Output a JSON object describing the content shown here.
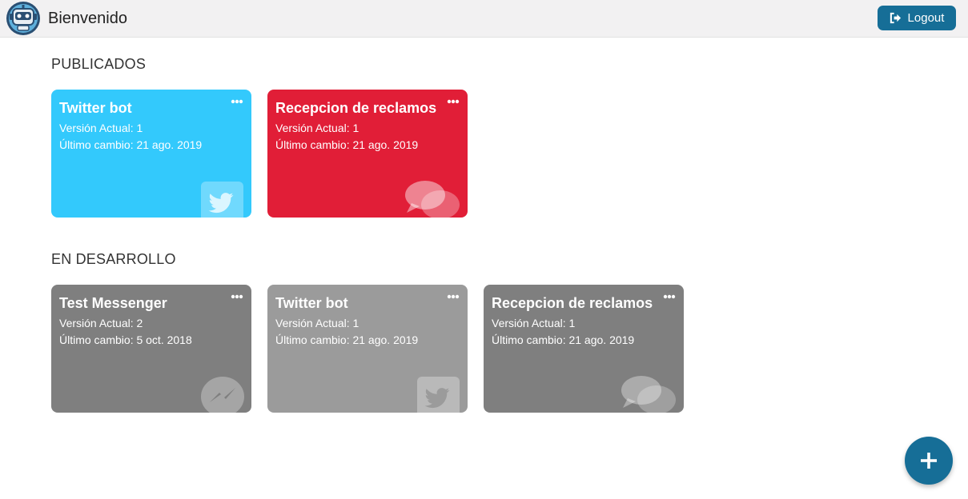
{
  "header": {
    "title": "Bienvenido",
    "logout_label": "Logout"
  },
  "sections": {
    "published": {
      "title": "PUBLICADOS",
      "cards": [
        {
          "title": "Twitter bot",
          "version": "Versión Actual: 1",
          "last_change": "Último cambio: 21 ago. 2019",
          "color": "#33c9fc",
          "icon": "twitter-icon"
        },
        {
          "title": "Recepcion de reclamos",
          "version": "Versión Actual: 1",
          "last_change": "Último cambio: 21 ago. 2019",
          "color": "#e11e37",
          "icon": "chat-bubbles-icon"
        }
      ]
    },
    "development": {
      "title": "EN DESARROLLO",
      "cards": [
        {
          "title": "Test Messenger",
          "version": "Versión Actual: 2",
          "last_change": "Último cambio: 5 oct. 2018",
          "color": "#7f7f7f",
          "icon": "messenger-icon"
        },
        {
          "title": "Twitter bot",
          "version": "Versión Actual: 1",
          "last_change": "Último cambio: 21 ago. 2019",
          "color": "#9b9b9b",
          "icon": "twitter-icon"
        },
        {
          "title": "Recepcion de reclamos",
          "version": "Versión Actual: 1",
          "last_change": "Último cambio: 21 ago. 2019",
          "color": "#7f7f7f",
          "icon": "chat-bubbles-icon"
        }
      ]
    }
  },
  "fab": {
    "icon": "plus-icon"
  },
  "colors": {
    "accent": "#166e97",
    "published_twitter": "#33c9fc",
    "published_chat": "#e11e37",
    "dev_dark": "#7f7f7f",
    "dev_light": "#9b9b9b"
  }
}
